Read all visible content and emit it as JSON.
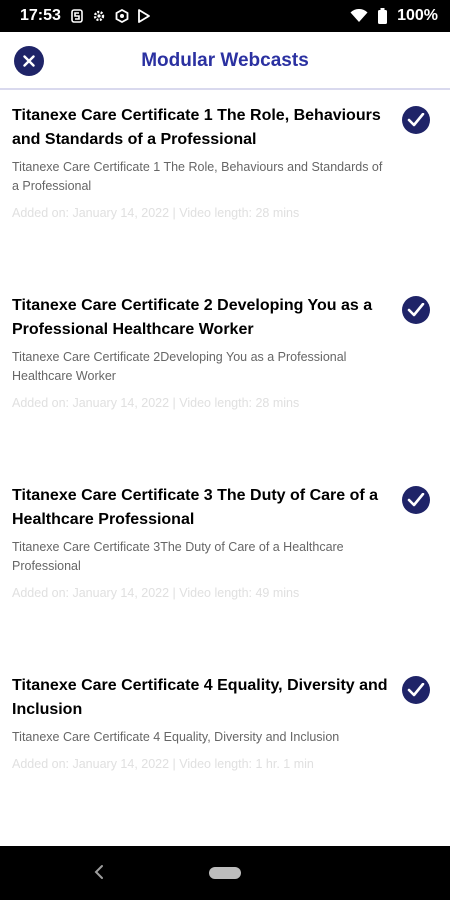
{
  "status_bar": {
    "time": "17:53",
    "battery": "100%",
    "icons": [
      "signal-s-icon",
      "settings-gear-icon",
      "snapshot-icon",
      "play-store-icon",
      "wifi-icon",
      "battery-icon"
    ]
  },
  "header": {
    "title": "Modular Webcasts",
    "close_icon": "close-icon"
  },
  "webcasts": [
    {
      "title": "Titanexe Care Certificate 1 The Role, Behaviours and Standards of a Professional",
      "description": "Titanexe Care Certificate 1 The Role, Behaviours and Standards of a Professional",
      "meta": "Added on: January 14, 2022  |  Video length: 28 mins",
      "completed": true
    },
    {
      "title": "Titanexe Care Certificate 2 Developing You as a Professional Healthcare Worker",
      "description": "Titanexe Care Certificate 2Developing You as a Professional Healthcare Worker",
      "meta": "Added on: January 14, 2022  |  Video length: 28 mins",
      "completed": true
    },
    {
      "title": "Titanexe Care Certificate 3 The Duty of Care of a Healthcare Professional",
      "description": "Titanexe Care Certificate 3The Duty of Care of a Healthcare Professional",
      "meta": "Added on: January 14, 2022  |  Video length: 49 mins",
      "completed": true
    },
    {
      "title": "Titanexe Care Certificate 4 Equality, Diversity and Inclusion",
      "description": "Titanexe Care Certificate 4 Equality, Diversity and Inclusion",
      "meta": "Added on: January 14, 2022  |  Video length: 1 hr. 1 min",
      "completed": true
    }
  ],
  "colors": {
    "brand": "#1f2468",
    "title_color": "#2b31a1",
    "meta_color": "#e0e0e0"
  }
}
